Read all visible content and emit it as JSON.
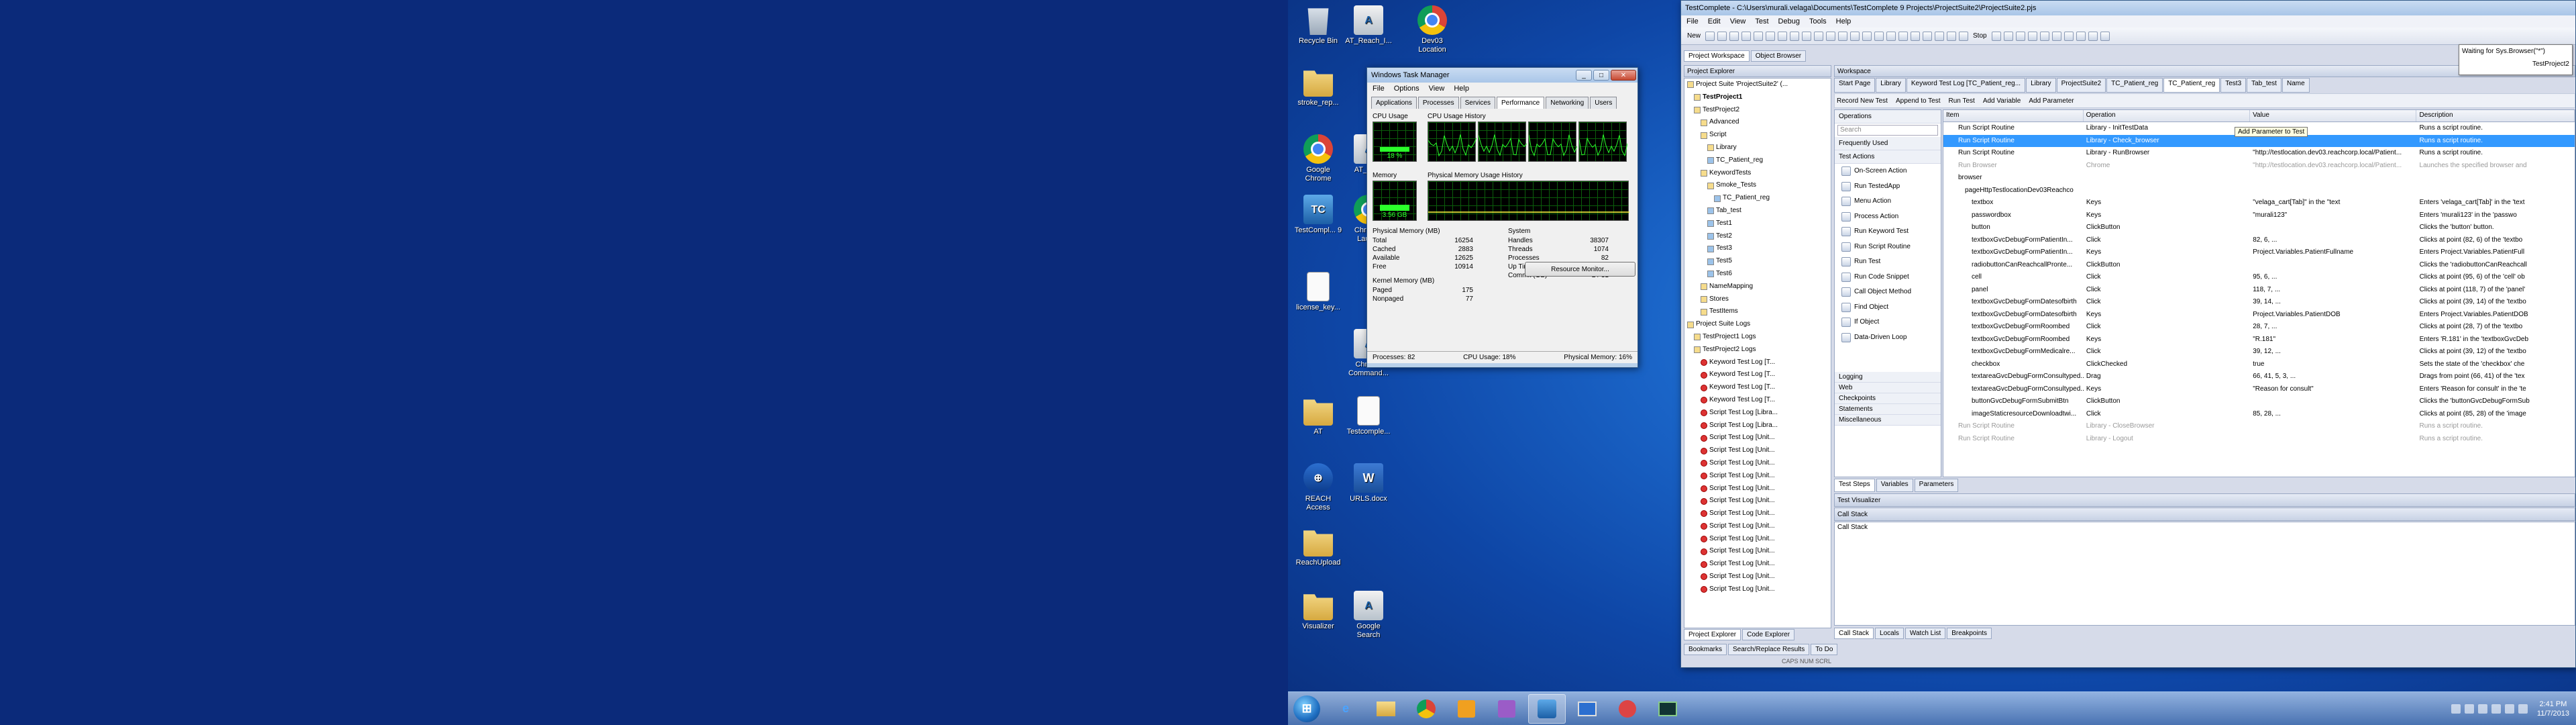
{
  "desktop_icons": [
    {
      "name": "recycle-bin-icon",
      "label": "Recycle Bin",
      "kind": "recycle"
    },
    {
      "name": "at-reach-icon",
      "label": "AT_Reach_I...",
      "kind": "app"
    },
    {
      "name": "dev03-location-icon",
      "label": "Dev03 Location",
      "kind": "chrome"
    },
    {
      "name": "stroke-rep-icon",
      "label": "stroke_rep...",
      "kind": "folder"
    },
    {
      "name": "google-chrome-icon",
      "label": "Google Chrome",
      "kind": "chrome"
    },
    {
      "name": "at-reach-2-icon",
      "label": "AT_Re...",
      "kind": "app"
    },
    {
      "name": "testcomplete-9-icon",
      "label": "TestCompl... 9",
      "kind": "tc"
    },
    {
      "name": "chrome-launch-icon",
      "label": "Chrom... Laun...",
      "kind": "chrome"
    },
    {
      "name": "license-key-icon",
      "label": "license_key...",
      "kind": "doc"
    },
    {
      "name": "chrome-command-icon",
      "label": "Chrome Command...",
      "kind": "app"
    },
    {
      "name": "at-icon",
      "label": "AT",
      "kind": "folder"
    },
    {
      "name": "testcomplete-doc-icon",
      "label": "Testcomple...",
      "kind": "doc"
    },
    {
      "name": "reach-access-icon",
      "label": "REACH Access",
      "kind": "reach"
    },
    {
      "name": "urls-docx-icon",
      "label": "URLS.docx",
      "kind": "word"
    },
    {
      "name": "reachupload-icon",
      "label": "ReachUpload",
      "kind": "folder"
    },
    {
      "name": "visualizer-icon",
      "label": "Visualizer",
      "kind": "folder"
    },
    {
      "name": "google-search-icon",
      "label": "Google Search",
      "kind": "app"
    }
  ],
  "taskmgr": {
    "title": "Windows Task Manager",
    "menu": [
      "File",
      "Options",
      "View",
      "Help"
    ],
    "tabs": [
      "Applications",
      "Processes",
      "Services",
      "Performance",
      "Networking",
      "Users"
    ],
    "active_tab": "Performance",
    "cpu_usage_label": "CPU Usage",
    "cpu_value": "18 %",
    "cpu_history_label": "CPU Usage History",
    "memory_label": "Memory",
    "memory_value": "3.56 GB",
    "mem_history_label": "Physical Memory Usage History",
    "physical_memory": {
      "heading": "Physical Memory (MB)",
      "rows": [
        [
          "Total",
          "16254"
        ],
        [
          "Cached",
          "2883"
        ],
        [
          "Available",
          "12625"
        ],
        [
          "Free",
          "10914"
        ]
      ]
    },
    "kernel_memory": {
      "heading": "Kernel Memory (MB)",
      "rows": [
        [
          "Paged",
          "175"
        ],
        [
          "Nonpaged",
          "77"
        ]
      ]
    },
    "system": {
      "heading": "System",
      "rows": [
        [
          "Handles",
          "38307"
        ],
        [
          "Threads",
          "1074"
        ],
        [
          "Processes",
          "82"
        ],
        [
          "Up Time",
          "0:01:43:03"
        ],
        [
          "Commit (GB)",
          "2 / 31"
        ]
      ]
    },
    "resource_monitor_btn": "Resource Monitor...",
    "status": {
      "processes": "Processes: 82",
      "cpu": "CPU Usage: 18%",
      "memory": "Physical Memory: 16%"
    },
    "cpu_fill": 0.18,
    "mem_fill": 0.22
  },
  "tc": {
    "title": "TestComplete - C:\\Users\\murali.velaga\\Documents\\TestComplete 9 Projects\\ProjectSuite2\\ProjectSuite2.pjs",
    "menu": [
      "File",
      "Edit",
      "View",
      "Test",
      "Debug",
      "Tools",
      "Help"
    ],
    "stop_label": "Stop",
    "new_label": "New",
    "workspace_tabs": [
      "Project Workspace",
      "Object Browser"
    ],
    "explorer_title": "Project Explorer",
    "workspace_title": "Workspace",
    "tabs": [
      "Start Page",
      "Library",
      "Keyword Test Log [TC_Patient_reg...",
      "Library",
      "ProjectSuite2",
      "TC_Patient_reg",
      "TC_Patient_reg",
      "Test3",
      "Tab_test",
      "Name"
    ],
    "active_tab_index": 6,
    "kw_toolbar": [
      "Record New Test",
      "Append to Test",
      "Run Test",
      "Add Variable",
      "Add Parameter"
    ],
    "tree": [
      "Project Suite 'ProjectSuite2' (...",
      "TestProject1",
      "TestProject2",
      "Advanced",
      "Script",
      "Library",
      "TC_Patient_reg",
      "KeywordTests",
      "Smoke_Tests",
      "TC_Patient_reg",
      "Tab_test",
      "Test1",
      "Test2",
      "Test3",
      "Test5",
      "Test6",
      "NameMapping",
      "Stores",
      "TestItems",
      "Project Suite Logs",
      "TestProject1 Logs",
      "TestProject2 Logs",
      "Keyword Test Log [T...",
      "Keyword Test Log [T...",
      "Keyword Test Log [T...",
      "Keyword Test Log [T...",
      "Script Test Log [Libra...",
      "Script Test Log [Libra...",
      "Script Test Log [Unit...",
      "Script Test Log [Unit...",
      "Script Test Log [Unit...",
      "Script Test Log [Unit...",
      "Script Test Log [Unit...",
      "Script Test Log [Unit...",
      "Script Test Log [Unit...",
      "Script Test Log [Unit...",
      "Script Test Log [Unit...",
      "Script Test Log [Unit...",
      "Script Test Log [Unit...",
      "Script Test Log [Unit...",
      "Script Test Log [Unit..."
    ],
    "explorer_tabs": [
      "Project Explorer",
      "Code Explorer"
    ],
    "ops_title": "Operations",
    "ops_search": "Search",
    "ops_groups": [
      "Frequently Used",
      "Test Actions"
    ],
    "ops_items": [
      "On-Screen Action",
      "Run TestedApp",
      "Menu Action",
      "Process Action",
      "Run Keyword Test",
      "Run Script Routine",
      "Run Test",
      "Run Code Snippet",
      "Call Object Method",
      "Find Object",
      "If Object",
      "Data-Driven Loop"
    ],
    "ops_groups2": [
      "Logging",
      "Web",
      "Checkpoints",
      "Statements",
      "Miscellaneous"
    ],
    "grid_headers": [
      "Item",
      "Operation",
      "Value",
      "Description"
    ],
    "grid_rows": [
      [
        "Run Script Routine",
        "Library - InitTestData",
        "",
        "Runs a script routine."
      ],
      [
        "Run Script Routine",
        "Library - Check_browser",
        "",
        "Runs a script routine."
      ],
      [
        "Run Script Routine",
        "Library - RunBrowser",
        "\"http://testlocation.dev03.reachcorp.local/Patient...",
        "Runs a script routine."
      ],
      [
        "Run Browser",
        "Chrome",
        "\"http://testlocation.dev03.reachcorp.local/Patient...",
        "Launches the specified browser and"
      ],
      [
        "browser",
        "",
        "",
        ""
      ],
      [
        "pageHttpTestlocationDev03Reachco",
        "",
        "",
        ""
      ],
      [
        "textbox",
        "Keys",
        "\"velaga_cart[Tab]\" in the \"text",
        "Enters 'velaga_cart[Tab]' in the 'text"
      ],
      [
        "passwordbox",
        "Keys",
        "\"murali123\"",
        "Enters 'murali123' in the 'passwo"
      ],
      [
        "button",
        "ClickButton",
        "",
        "Clicks the 'button' button."
      ],
      [
        "textboxGvcDebugFormPatientIn...",
        "Click",
        "82, 6, ...",
        "Clicks at point (82, 6) of the 'textbo"
      ],
      [
        "textboxGvcDebugFormPatientIn...",
        "Keys",
        "Project.Variables.PatientFullname",
        "Enters Project.Variables.PatientFull"
      ],
      [
        "radiobuttonCanReachcallPronte...",
        "ClickButton",
        "",
        "Clicks the 'radiobuttonCanReachcall"
      ],
      [
        "cell",
        "Click",
        "95, 6, ...",
        "Clicks at point (95, 6) of the 'cell' ob"
      ],
      [
        "panel",
        "Click",
        "118, 7, ...",
        "Clicks at point (118, 7) of the 'panel'"
      ],
      [
        "textboxGvcDebugFormDatesofbirth",
        "Click",
        "39, 14, ...",
        "Clicks at point (39, 14) of the 'textbo"
      ],
      [
        "textboxGvcDebugFormDatesofbirth",
        "Keys",
        "Project.Variables.PatientDOB",
        "Enters Project.Variables.PatientDOB"
      ],
      [
        "textboxGvcDebugFormRoombed",
        "Click",
        "28, 7, ...",
        "Clicks at point (28, 7) of the 'textbo"
      ],
      [
        "textboxGvcDebugFormRoombed",
        "Keys",
        "\"R.181\"",
        "Enters 'R.181' in the 'textboxGvcDeb"
      ],
      [
        "textboxGvcDebugFormMedicalre...",
        "Click",
        "39, 12, ...",
        "Clicks at point (39, 12) of the 'textbo"
      ],
      [
        "checkbox",
        "ClickChecked",
        "true",
        "Sets the state of the 'checkbox' che"
      ],
      [
        "textareaGvcDebugFormConsultyped...",
        "Drag",
        "66, 41, 5, 3, ...",
        "Drags from point (66, 41) of the 'tex"
      ],
      [
        "textareaGvcDebugFormConsultyped...",
        "Keys",
        "\"Reason for consult\"",
        "Enters 'Reason for consult' in the 'te"
      ],
      [
        "buttonGvcDebugFormSubmitBtn",
        "ClickButton",
        "",
        "Clicks the 'buttonGvcDebugFormSub"
      ],
      [
        "imageStaticresourceDownloadtwi...",
        "Click",
        "85, 28, ...",
        "Clicks at point (85, 28) of the 'image"
      ],
      [
        "Run Script Routine",
        "Library - CloseBrowser",
        "",
        "Runs a script routine."
      ],
      [
        "Run Script Routine",
        "Library - Logout",
        "",
        "Runs a script routine."
      ]
    ],
    "selected_row": 1,
    "bottom_tabs": [
      "Test Steps",
      "Variables",
      "Parameters"
    ],
    "test_visualizer": "Test Visualizer",
    "call_stack_title": "Call Stack",
    "call_stack_col": "Call Stack",
    "cs_tabs": [
      "Call Stack",
      "Locals",
      "Watch List",
      "Breakpoints"
    ],
    "lower_tabs": [
      "Bookmarks",
      "Search/Replace Results",
      "To Do"
    ],
    "statusbar": "CAPS  NUM  SCRL"
  },
  "tooltip": {
    "line1": "Waiting for Sys.Browser(\"*\")",
    "line2": "TestProject2"
  },
  "add_param_hint": "Add Parameter to Test",
  "clock": {
    "time": "2:41 PM",
    "date": "11/7/2013"
  }
}
